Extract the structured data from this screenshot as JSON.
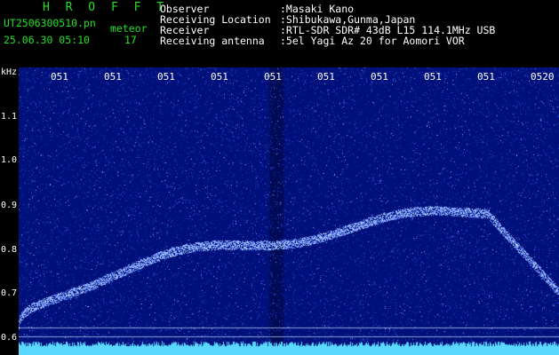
{
  "header": {
    "brand": "H R O F F T",
    "filename": "UT2506300510.pn",
    "meteor_label": "meteor",
    "date": "25.06.30 05:10",
    "count": "17",
    "fields": [
      {
        "label": "Observer",
        "value": ":Masaki Kano"
      },
      {
        "label": "Receiving Location",
        "value": ":Shibukawa,Gunma,Japan"
      },
      {
        "label": "Receiver",
        "value": ":RTL-SDR SDR# 43dB L15 114.1MHz USB"
      },
      {
        "label": "Receiving antenna",
        "value": ":5el Yagi Az 20 for Aomori VOR"
      }
    ]
  },
  "axis": {
    "unit": "kHz",
    "labels": [
      "1.1",
      "1.0",
      "0.9",
      "0.8",
      "0.7",
      "0.6"
    ],
    "time_ticks": [
      "051",
      "051",
      "051",
      "051",
      "051",
      "051",
      "051",
      "051",
      "051",
      "0520"
    ]
  },
  "colors": {
    "background": "#00107a",
    "noise": "#2a4fd8",
    "signal": "#a8c8ff",
    "baseline": "#5ad8ff"
  }
}
